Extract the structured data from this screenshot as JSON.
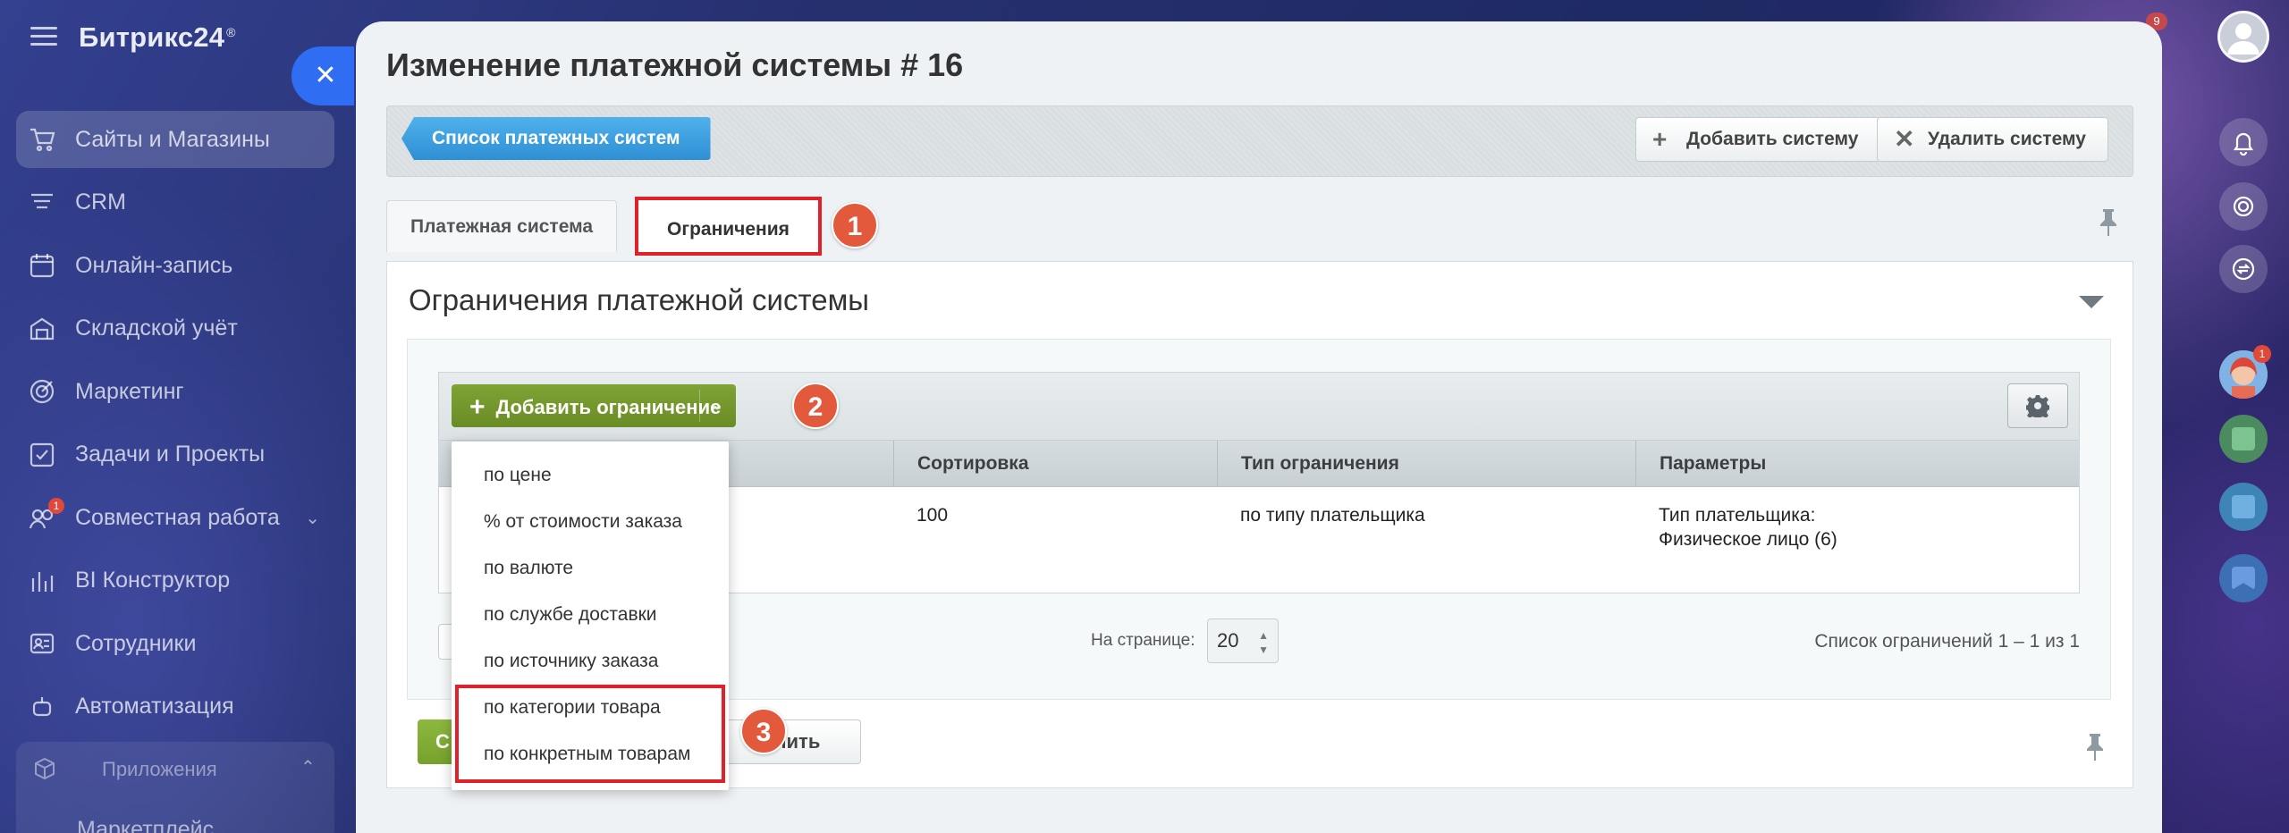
{
  "app": {
    "logo": "Битрикс24",
    "logo_mark": "®"
  },
  "sidebar": {
    "items": [
      {
        "label": "Сайты и Магазины",
        "icon": "cart-icon"
      },
      {
        "label": "CRM",
        "icon": "crm-icon"
      },
      {
        "label": "Онлайн-запись",
        "icon": "calendar-icon"
      },
      {
        "label": "Складской учёт",
        "icon": "warehouse-icon"
      },
      {
        "label": "Маркетинг",
        "icon": "target-icon"
      },
      {
        "label": "Задачи и Проекты",
        "icon": "task-icon"
      },
      {
        "label": "Совместная работа",
        "icon": "collab-icon",
        "badge": "1"
      },
      {
        "label": "BI Конструктор",
        "icon": "chart-icon"
      },
      {
        "label": "Сотрудники",
        "icon": "employees-icon"
      },
      {
        "label": "Автоматизация",
        "icon": "automation-icon"
      }
    ],
    "group_title": "Приложения",
    "group_sub": "Маркетплейс"
  },
  "rightbar": {
    "top_count": "9",
    "chat_badge": "1"
  },
  "page": {
    "title": "Изменение платежной системы # 16"
  },
  "toolbar": {
    "list_label": "Список платежных систем",
    "add_label": "Добавить систему",
    "delete_label": "Удалить систему"
  },
  "tabs": {
    "payment": "Платежная система",
    "restrictions": "Ограничения"
  },
  "steps": {
    "s1": "1",
    "s2": "2",
    "s3": "3"
  },
  "section": {
    "title": "Ограничения платежной системы"
  },
  "grid": {
    "add_restriction": "Добавить ограничение",
    "columns": [
      "Сортировка",
      "Тип ограничения",
      "Параметры"
    ],
    "row": {
      "sort": "100",
      "type": "по типу плательщика",
      "params_line1": "Тип плательщика:",
      "params_line2": "Физическое лицо (6)"
    },
    "per_page_label": "На странице:",
    "per_page_value": "20",
    "count_label": "Список ограничений 1 – 1 из 1"
  },
  "footer": {
    "save_label": "С",
    "cancel_label": "енить"
  },
  "dropdown": {
    "items": [
      "по цене",
      "% от стоимости заказа",
      "по валюте",
      "по службе доставки",
      "по источнику заказа",
      "по категории товара",
      "по конкретным товарам"
    ]
  },
  "colors": {
    "accent_blue": "#2f6df2",
    "highlight_red": "#e02129",
    "step_orange": "#e25a3b",
    "green_button": "#6a8c26"
  }
}
